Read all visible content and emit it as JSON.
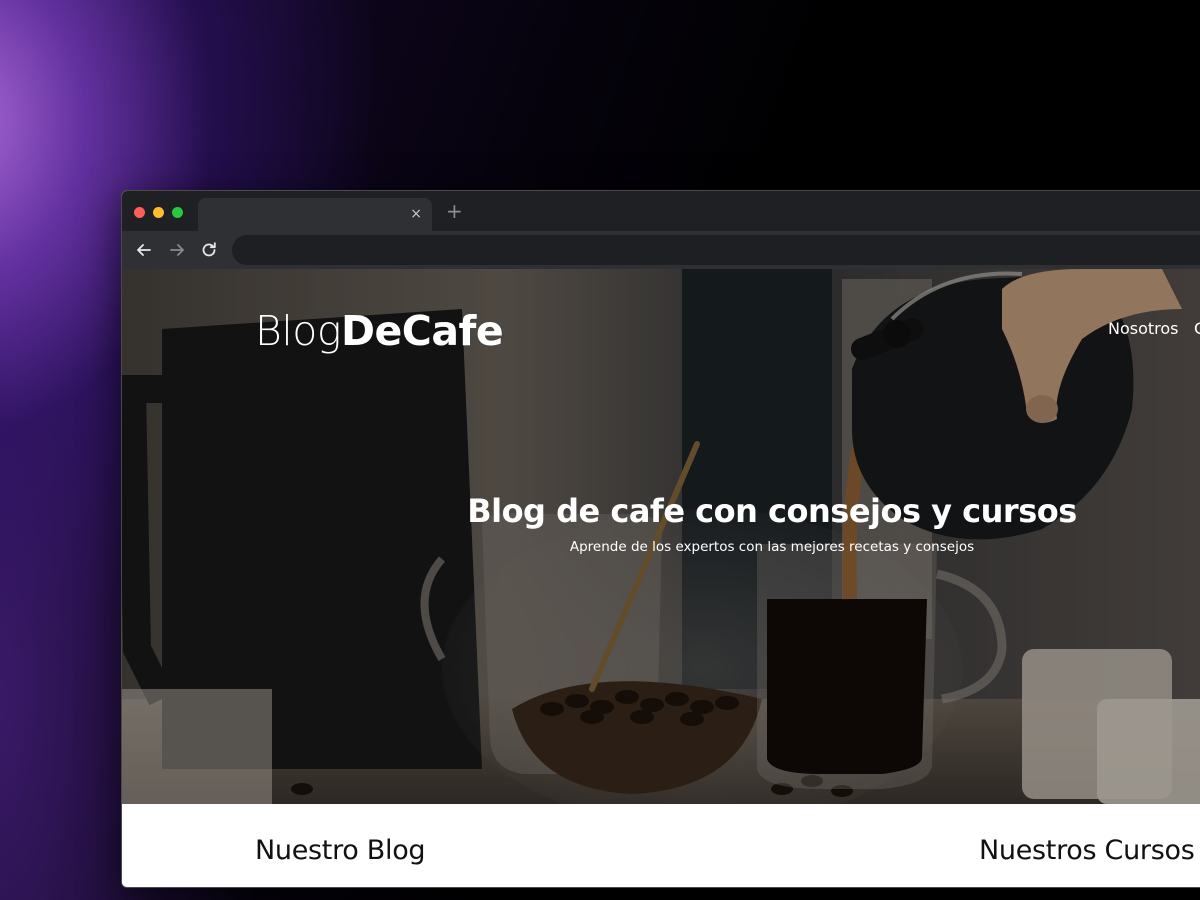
{
  "browser": {
    "tab": {
      "title": "",
      "close_label": "×"
    },
    "new_tab_label": "+",
    "address": {
      "value": "",
      "placeholder": ""
    }
  },
  "site": {
    "logo": {
      "part_light": "Blog",
      "part_bold": "DeCafe"
    },
    "nav": [
      {
        "label": "Nosotros"
      },
      {
        "label": "C"
      }
    ],
    "hero": {
      "title": "Blog de cafe con consejos y cursos",
      "subtitle": "Aprende de los expertos con las mejores recetas y consejos"
    },
    "sections": [
      {
        "heading": "Nuestro Blog"
      },
      {
        "heading": "Nuestros Cursos y"
      }
    ]
  },
  "colors": {
    "chrome_dark": "#1f2023",
    "chrome_toolbar": "#2f3034",
    "close_red": "#ff5f57",
    "minimize_yellow": "#febc2e",
    "maximize_green": "#28c840"
  }
}
